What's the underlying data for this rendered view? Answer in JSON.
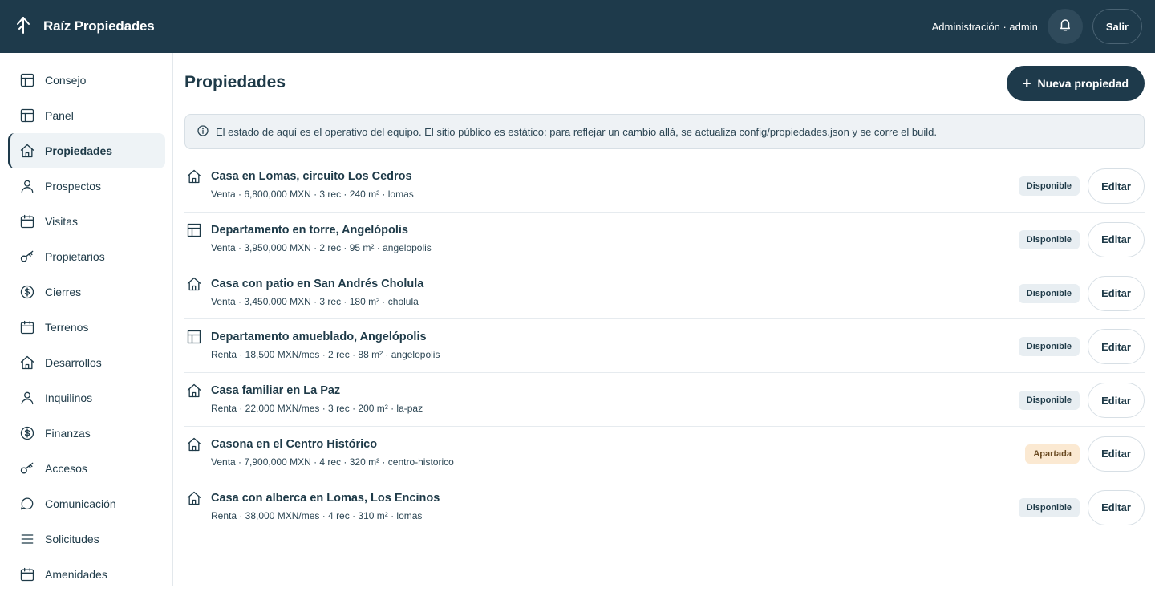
{
  "header": {
    "brand": "Raíz Propiedades",
    "role": "Administración · admin",
    "logout_label": "Salir"
  },
  "sidebar": {
    "items": [
      {
        "label": "Consejo",
        "icon": "layout-icon"
      },
      {
        "label": "Panel",
        "icon": "layout-icon"
      },
      {
        "label": "Propiedades",
        "icon": "house-icon",
        "active": true
      },
      {
        "label": "Prospectos",
        "icon": "user-icon"
      },
      {
        "label": "Visitas",
        "icon": "calendar-icon"
      },
      {
        "label": "Propietarios",
        "icon": "key-icon"
      },
      {
        "label": "Cierres",
        "icon": "dollar-icon"
      },
      {
        "label": "Terrenos",
        "icon": "calendar-icon"
      },
      {
        "label": "Desarrollos",
        "icon": "house-icon"
      },
      {
        "label": "Inquilinos",
        "icon": "user-icon"
      },
      {
        "label": "Finanzas",
        "icon": "dollar-icon"
      },
      {
        "label": "Accesos",
        "icon": "key-icon"
      },
      {
        "label": "Comunicación",
        "icon": "chat-icon"
      },
      {
        "label": "Solicitudes",
        "icon": "list-icon"
      },
      {
        "label": "Amenidades",
        "icon": "calendar-icon"
      }
    ]
  },
  "main": {
    "title": "Propiedades",
    "new_button": "Nueva propiedad",
    "notice": "El estado de aquí es el operativo del equipo. El sitio público es estático: para reflejar un cambio allá, se actualiza config/propiedades.json y se corre el build.",
    "edit_label": "Editar",
    "properties": [
      {
        "title": "Casa en Lomas, circuito Los Cedros",
        "meta": "Venta · 6,800,000 MXN · 3 rec · 240 m² · lomas",
        "status": "Disponible",
        "status_kind": "ok",
        "icon": "house-icon"
      },
      {
        "title": "Departamento en torre, Angelópolis",
        "meta": "Venta · 3,950,000 MXN · 2 rec · 95 m² · angelopolis",
        "status": "Disponible",
        "status_kind": "ok",
        "icon": "building-icon"
      },
      {
        "title": "Casa con patio en San Andrés Cholula",
        "meta": "Venta · 3,450,000 MXN · 3 rec · 180 m² · cholula",
        "status": "Disponible",
        "status_kind": "ok",
        "icon": "house-icon"
      },
      {
        "title": "Departamento amueblado, Angelópolis",
        "meta": "Renta · 18,500 MXN/mes · 2 rec · 88 m² · angelopolis",
        "status": "Disponible",
        "status_kind": "ok",
        "icon": "building-icon"
      },
      {
        "title": "Casa familiar en La Paz",
        "meta": "Renta · 22,000 MXN/mes · 3 rec · 200 m² · la-paz",
        "status": "Disponible",
        "status_kind": "ok",
        "icon": "house-icon"
      },
      {
        "title": "Casona en el Centro Histórico",
        "meta": "Venta · 7,900,000 MXN · 4 rec · 320 m² · centro-historico",
        "status": "Apartada",
        "status_kind": "warn",
        "icon": "house-icon"
      },
      {
        "title": "Casa con alberca en Lomas, Los Encinos",
        "meta": "Renta · 38,000 MXN/mes · 4 rec · 310 m² · lomas",
        "status": "Disponible",
        "status_kind": "ok",
        "icon": "house-icon"
      }
    ]
  },
  "colors": {
    "primary": "#1e3a4b",
    "badge_ok_bg": "#e8eef2",
    "badge_warn_bg": "#fbe9d2"
  }
}
